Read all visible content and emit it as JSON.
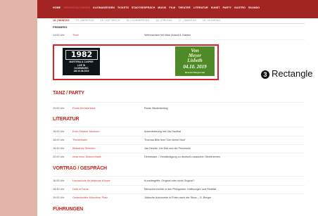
{
  "nav": {
    "items": [
      "HOME",
      "VERANSTALTUNGEN",
      "KLEINANZEIGEN",
      "TICKETS",
      "STADTGESPRÄCH",
      "MUSIK",
      "FILM",
      "THEATER",
      "LITERATUR",
      "KUNST",
      "PARTY",
      "GASTRO",
      "SKANDO"
    ],
    "active_index": 1
  },
  "days": {
    "items": [
      "18. | MONTAG",
      "19. | DIENSTAG",
      "15. | MITTWOCH",
      "15. | DONNERSTAG",
      "16. | FREITAG",
      "17. | SAMSTAG",
      "18. | SONNTAG"
    ],
    "active_index": 0
  },
  "city": "FREIBERG",
  "freiberg_rows": [
    {
      "time": "14:00 Uhr",
      "loc": "Tivoli",
      "desc": "Weihnachten mit Maxi Arland & Gästen"
    }
  ],
  "ads": {
    "ad1": {
      "big": "1982",
      "line1": "MARTERIA & CASPER",
      "line2": "LIVE IN",
      "line3": "OLDENBURG",
      "line4": "AM 10.08.2019"
    },
    "ad2": {
      "line1": "Von",
      "line2": "Meyer",
      "line3": "Lisbeth",
      "line4": "04.10. 2019",
      "line5": "Brauhof Bürgersaal"
    }
  },
  "annotation": {
    "number": "3",
    "label": "Rectangle",
    "color": "#e02024"
  },
  "sections": {
    "tanz": {
      "title": "TANZ / PARTY",
      "rows": [
        {
          "time": "20:00 Uhr",
          "loc": "Roots Amüsierlokal",
          "desc": "Roots Studententag"
        }
      ]
    },
    "literatur": {
      "title": "LITERATUR",
      "rows": [
        {
          "time": "18:00 Uhr",
          "loc": "Erich Kästner Museum",
          "desc": "Adventslesung mit Uta Hauthal"
        },
        {
          "time": "18:00 Uhr",
          "loc": "Theaterkahn",
          "desc": "Thomas Bille liest \"Der kleine Nick\""
        },
        {
          "time": "18:30 Uhr",
          "loc": "Bibliothek Striehlen",
          "desc": "Jan Delzke: Der Bär und die Prinzessin"
        },
        {
          "time": "20:00 Uhr",
          "loc": "riesa efau. Motorenhalle",
          "desc": "Demoslam – Verständigung zu deutsch-russischen Streitthemen"
        }
      ]
    },
    "vortrag": {
      "title": "VORTRAG / GESPRÄCH",
      "rows": [
        {
          "time": "18:00 Uhr",
          "loc": "Hochschule für bildende Künste",
          "desc": "Kunstbegriffe: Original oder nicht Original?"
        },
        {
          "time": "18:30 Uhr",
          "loc": "Hole of Fame",
          "desc": "Menschenrechte in den Philippinen: Hoffnungen und Realität"
        },
        {
          "time": "19:00 Uhr",
          "loc": "Gedenkstätte Münchner Platz",
          "desc": "Jüdische Autonomie in Polen nach der Shoa – G. Berger"
        }
      ]
    },
    "fuehrungen": {
      "title": "FÜHRUNGEN"
    }
  }
}
